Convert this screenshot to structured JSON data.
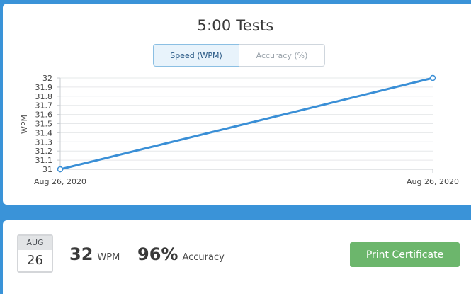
{
  "test": {
    "title": "5:00 Tests"
  },
  "toggle": {
    "speed_label": "Speed (WPM)",
    "accuracy_label": "Accuracy (%)",
    "selected": "speed"
  },
  "colors": {
    "page_background": "#3a93d8",
    "line": "#3a8fd6",
    "print_button": "#6cb66c"
  },
  "chart_data": {
    "type": "line",
    "ylabel": "WPM",
    "xlabel": "",
    "categories": [
      "Aug 26, 2020",
      "Aug 26, 2020"
    ],
    "series": [
      {
        "values": [
          31,
          32
        ]
      }
    ],
    "ylim": [
      31,
      32
    ],
    "yticks": [
      31,
      31.1,
      31.2,
      31.3,
      31.4,
      31.5,
      31.6,
      31.7,
      31.8,
      31.9,
      32
    ],
    "grid": true
  },
  "result": {
    "date_month": "AUG",
    "date_day": "26",
    "wpm_value": "32",
    "wpm_unit": "WPM",
    "accuracy_value": "96%",
    "accuracy_unit": "Accuracy",
    "print_label": "Print Certificate"
  }
}
